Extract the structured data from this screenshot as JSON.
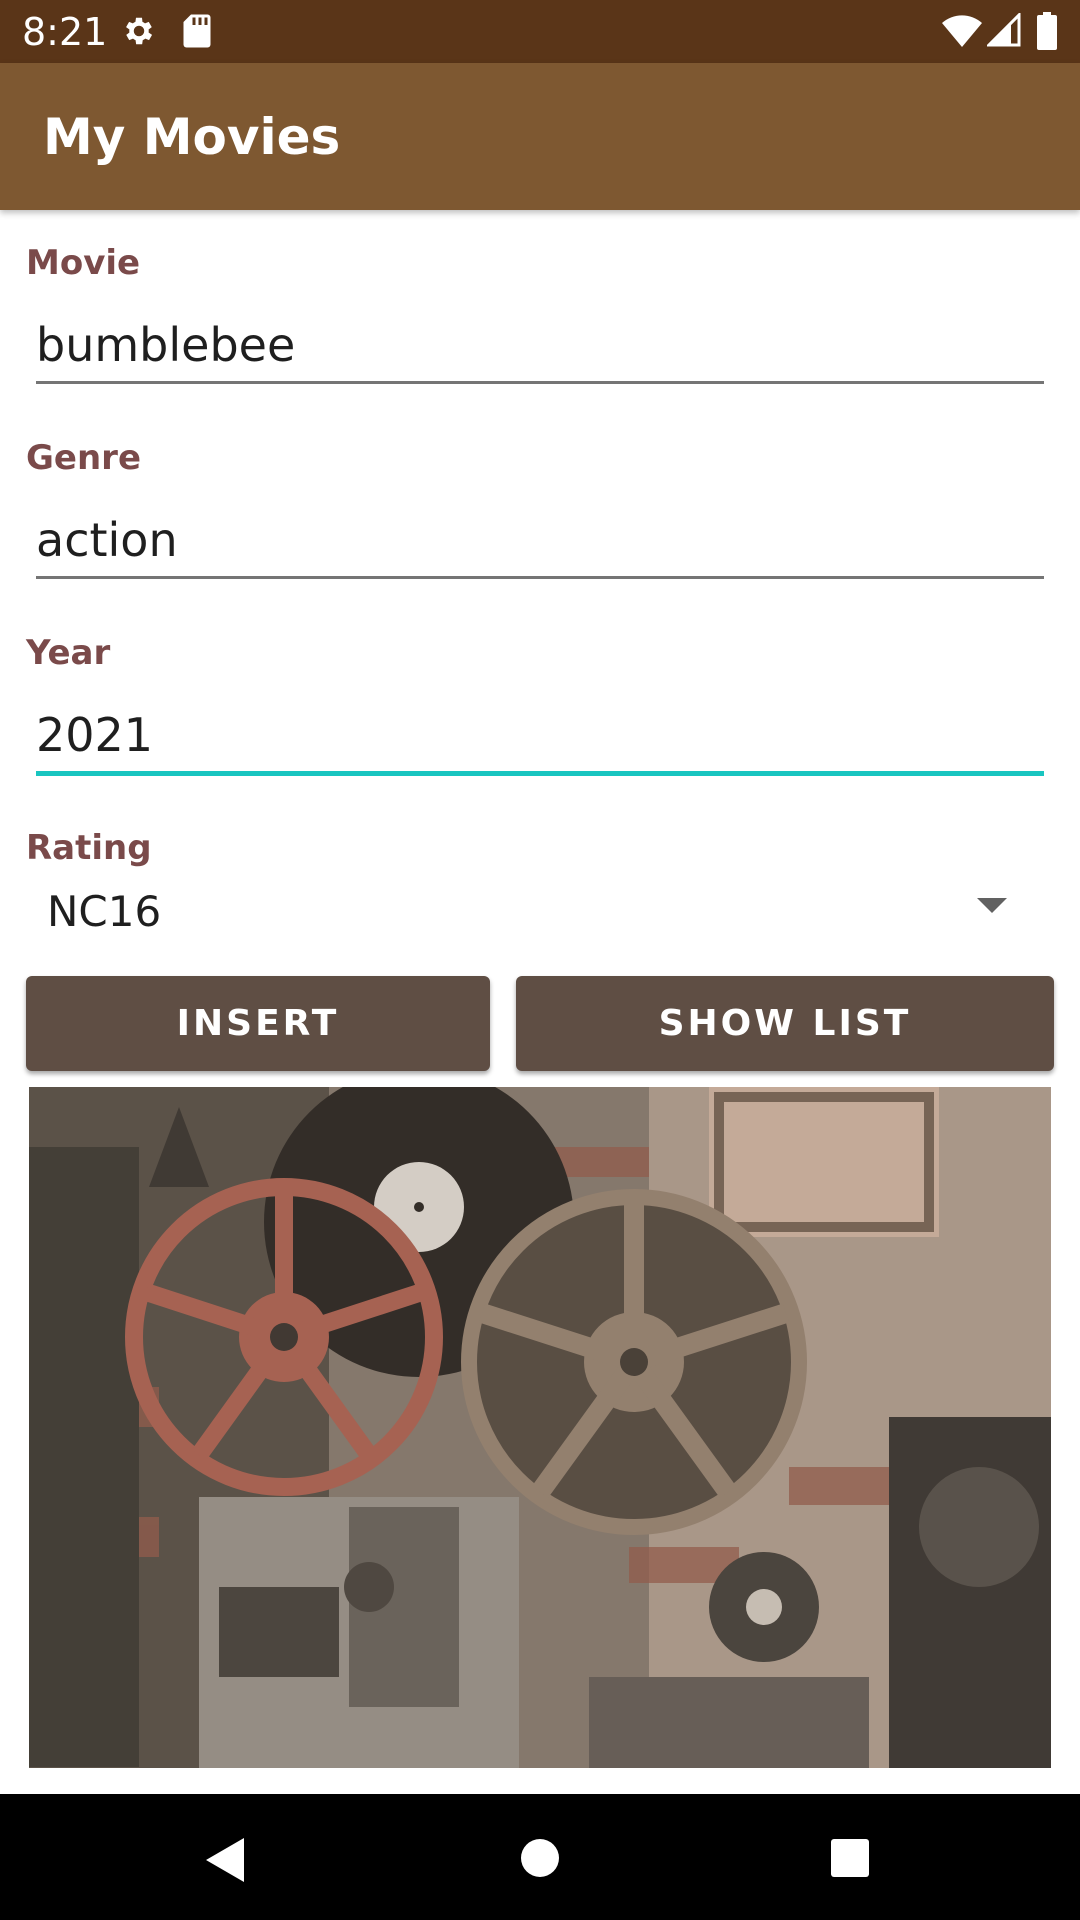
{
  "status_bar": {
    "time": "8:21",
    "left_icons": [
      "gear-icon",
      "sd-card-icon"
    ],
    "right_icons": [
      "wifi-icon",
      "signal-icon",
      "battery-icon"
    ]
  },
  "app_bar": {
    "title": "My Movies"
  },
  "form": {
    "movie": {
      "label": "Movie",
      "value": "bumblebee"
    },
    "genre": {
      "label": "Genre",
      "value": "action"
    },
    "year": {
      "label": "Year",
      "value": "2021"
    },
    "rating": {
      "label": "Rating",
      "selected": "NC16"
    }
  },
  "buttons": {
    "insert": "INSERT",
    "show_list": "SHOW LIST"
  },
  "image": {
    "subject": "vintage film reels and projectors"
  },
  "nav_bar": {
    "icons": [
      "back-icon",
      "home-icon",
      "recents-icon"
    ]
  },
  "colors": {
    "status_bar": "#5a3518",
    "app_bar": "#7e5831",
    "label": "#7a4a4a",
    "focus_underline": "#19c5c0",
    "button": "#5f4e44"
  }
}
